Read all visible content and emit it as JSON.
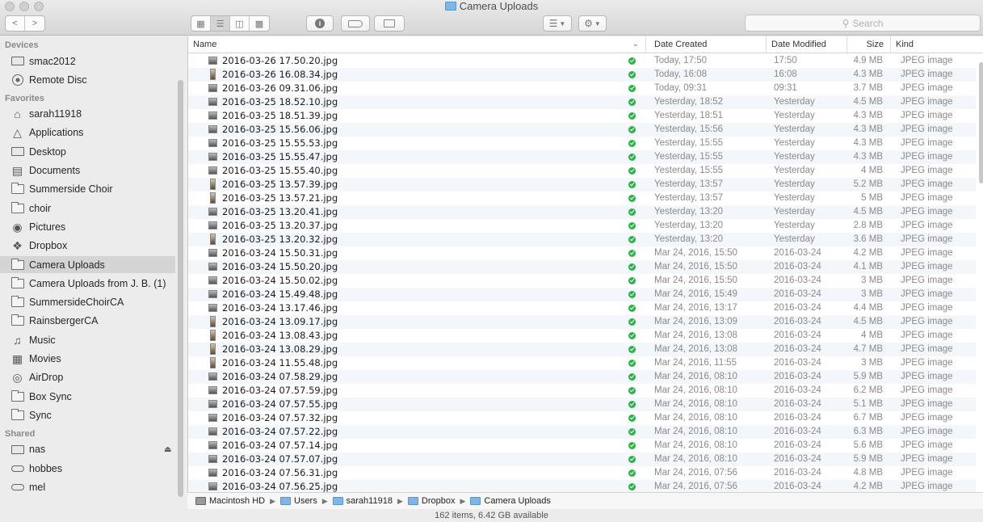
{
  "window": {
    "title": "Camera Uploads"
  },
  "toolbar": {
    "back_glyph": "<",
    "forward_glyph": ">",
    "view_icons": [
      "icon-view-icon",
      "list-view-icon",
      "column-view-icon",
      "coverflow-view-icon"
    ],
    "search_placeholder": "Search"
  },
  "sidebar": {
    "sections": [
      {
        "title": "Devices",
        "items": [
          {
            "label": "smac2012",
            "icon": "laptop-icon"
          },
          {
            "label": "Remote Disc",
            "icon": "disc-icon"
          }
        ]
      },
      {
        "title": "Favorites",
        "items": [
          {
            "label": "sarah11918",
            "icon": "home-icon"
          },
          {
            "label": "Applications",
            "icon": "applications-icon"
          },
          {
            "label": "Desktop",
            "icon": "desktop-icon"
          },
          {
            "label": "Documents",
            "icon": "documents-icon"
          },
          {
            "label": "Summerside Choir",
            "icon": "folder-icon"
          },
          {
            "label": "choir",
            "icon": "folder-icon"
          },
          {
            "label": "Pictures",
            "icon": "camera-icon"
          },
          {
            "label": "Dropbox",
            "icon": "dropbox-icon"
          },
          {
            "label": "Camera Uploads",
            "icon": "folder-icon",
            "selected": true
          },
          {
            "label": "Camera Uploads from J. B. (1)",
            "icon": "folder-icon"
          },
          {
            "label": "SummersideChoirCA",
            "icon": "folder-icon"
          },
          {
            "label": "RainsbergerCA",
            "icon": "folder-icon"
          },
          {
            "label": "Music",
            "icon": "music-icon"
          },
          {
            "label": "Movies",
            "icon": "movies-icon"
          },
          {
            "label": "AirDrop",
            "icon": "airdrop-icon"
          },
          {
            "label": "Box Sync",
            "icon": "folder-icon"
          },
          {
            "label": "Sync",
            "icon": "folder-icon"
          }
        ]
      },
      {
        "title": "Shared",
        "items": [
          {
            "label": "nas",
            "icon": "server-icon",
            "eject": true
          },
          {
            "label": "hobbes",
            "icon": "network-computer-icon"
          },
          {
            "label": "mel",
            "icon": "network-computer-icon"
          }
        ]
      }
    ]
  },
  "columns": {
    "name": "Name",
    "created": "Date Created",
    "modified": "Date Modified",
    "size": "Size",
    "kind": "Kind"
  },
  "files": [
    {
      "name": "2016-03-26 17.50.20.jpg",
      "created": "Today, 17:50",
      "modified": "17:50",
      "size": "4.9 MB",
      "kind": "JPEG image",
      "orient": "land"
    },
    {
      "name": "2016-03-26 16.08.34.jpg",
      "created": "Today, 16:08",
      "modified": "16:08",
      "size": "4.3 MB",
      "kind": "JPEG image",
      "orient": "port"
    },
    {
      "name": "2016-03-26 09.31.06.jpg",
      "created": "Today, 09:31",
      "modified": "09:31",
      "size": "3.7 MB",
      "kind": "JPEG image",
      "orient": "land"
    },
    {
      "name": "2016-03-25 18.52.10.jpg",
      "created": "Yesterday, 18:52",
      "modified": "Yesterday",
      "size": "4.5 MB",
      "kind": "JPEG image",
      "orient": "land"
    },
    {
      "name": "2016-03-25 18.51.39.jpg",
      "created": "Yesterday, 18:51",
      "modified": "Yesterday",
      "size": "4.3 MB",
      "kind": "JPEG image",
      "orient": "land"
    },
    {
      "name": "2016-03-25 15.56.06.jpg",
      "created": "Yesterday, 15:56",
      "modified": "Yesterday",
      "size": "4.3 MB",
      "kind": "JPEG image",
      "orient": "land"
    },
    {
      "name": "2016-03-25 15.55.53.jpg",
      "created": "Yesterday, 15:55",
      "modified": "Yesterday",
      "size": "4.3 MB",
      "kind": "JPEG image",
      "orient": "land"
    },
    {
      "name": "2016-03-25 15.55.47.jpg",
      "created": "Yesterday, 15:55",
      "modified": "Yesterday",
      "size": "4.3 MB",
      "kind": "JPEG image",
      "orient": "land"
    },
    {
      "name": "2016-03-25 15.55.40.jpg",
      "created": "Yesterday, 15:55",
      "modified": "Yesterday",
      "size": "4 MB",
      "kind": "JPEG image",
      "orient": "land"
    },
    {
      "name": "2016-03-25 13.57.39.jpg",
      "created": "Yesterday, 13:57",
      "modified": "Yesterday",
      "size": "5.2 MB",
      "kind": "JPEG image",
      "orient": "port"
    },
    {
      "name": "2016-03-25 13.57.21.jpg",
      "created": "Yesterday, 13:57",
      "modified": "Yesterday",
      "size": "5 MB",
      "kind": "JPEG image",
      "orient": "port"
    },
    {
      "name": "2016-03-25 13.20.41.jpg",
      "created": "Yesterday, 13:20",
      "modified": "Yesterday",
      "size": "4.5 MB",
      "kind": "JPEG image",
      "orient": "land"
    },
    {
      "name": "2016-03-25 13.20.37.jpg",
      "created": "Yesterday, 13:20",
      "modified": "Yesterday",
      "size": "2.8 MB",
      "kind": "JPEG image",
      "orient": "land"
    },
    {
      "name": "2016-03-25 13.20.32.jpg",
      "created": "Yesterday, 13:20",
      "modified": "Yesterday",
      "size": "3.6 MB",
      "kind": "JPEG image",
      "orient": "port"
    },
    {
      "name": "2016-03-24 15.50.31.jpg",
      "created": "Mar 24, 2016, 15:50",
      "modified": "2016-03-24",
      "size": "4.2 MB",
      "kind": "JPEG image",
      "orient": "land"
    },
    {
      "name": "2016-03-24 15.50.20.jpg",
      "created": "Mar 24, 2016, 15:50",
      "modified": "2016-03-24",
      "size": "4.1 MB",
      "kind": "JPEG image",
      "orient": "land"
    },
    {
      "name": "2016-03-24 15.50.02.jpg",
      "created": "Mar 24, 2016, 15:50",
      "modified": "2016-03-24",
      "size": "3 MB",
      "kind": "JPEG image",
      "orient": "land"
    },
    {
      "name": "2016-03-24 15.49.48.jpg",
      "created": "Mar 24, 2016, 15:49",
      "modified": "2016-03-24",
      "size": "3 MB",
      "kind": "JPEG image",
      "orient": "land"
    },
    {
      "name": "2016-03-24 13.17.46.jpg",
      "created": "Mar 24, 2016, 13:17",
      "modified": "2016-03-24",
      "size": "4.4 MB",
      "kind": "JPEG image",
      "orient": "land"
    },
    {
      "name": "2016-03-24 13.09.17.jpg",
      "created": "Mar 24, 2016, 13:09",
      "modified": "2016-03-24",
      "size": "4.5 MB",
      "kind": "JPEG image",
      "orient": "port"
    },
    {
      "name": "2016-03-24 13.08.43.jpg",
      "created": "Mar 24, 2016, 13:08",
      "modified": "2016-03-24",
      "size": "4 MB",
      "kind": "JPEG image",
      "orient": "port"
    },
    {
      "name": "2016-03-24 13.08.29.jpg",
      "created": "Mar 24, 2016, 13:08",
      "modified": "2016-03-24",
      "size": "4.7 MB",
      "kind": "JPEG image",
      "orient": "port"
    },
    {
      "name": "2016-03-24 11.55.48.jpg",
      "created": "Mar 24, 2016, 11:55",
      "modified": "2016-03-24",
      "size": "3 MB",
      "kind": "JPEG image",
      "orient": "port"
    },
    {
      "name": "2016-03-24 07.58.29.jpg",
      "created": "Mar 24, 2016, 08:10",
      "modified": "2016-03-24",
      "size": "5.9 MB",
      "kind": "JPEG image",
      "orient": "land"
    },
    {
      "name": "2016-03-24 07.57.59.jpg",
      "created": "Mar 24, 2016, 08:10",
      "modified": "2016-03-24",
      "size": "6.2 MB",
      "kind": "JPEG image",
      "orient": "land"
    },
    {
      "name": "2016-03-24 07.57.55.jpg",
      "created": "Mar 24, 2016, 08:10",
      "modified": "2016-03-24",
      "size": "5.1 MB",
      "kind": "JPEG image",
      "orient": "land"
    },
    {
      "name": "2016-03-24 07.57.32.jpg",
      "created": "Mar 24, 2016, 08:10",
      "modified": "2016-03-24",
      "size": "6.7 MB",
      "kind": "JPEG image",
      "orient": "land"
    },
    {
      "name": "2016-03-24 07.57.22.jpg",
      "created": "Mar 24, 2016, 08:10",
      "modified": "2016-03-24",
      "size": "6.3 MB",
      "kind": "JPEG image",
      "orient": "land"
    },
    {
      "name": "2016-03-24 07.57.14.jpg",
      "created": "Mar 24, 2016, 08:10",
      "modified": "2016-03-24",
      "size": "5.6 MB",
      "kind": "JPEG image",
      "orient": "land"
    },
    {
      "name": "2016-03-24 07.57.07.jpg",
      "created": "Mar 24, 2016, 08:10",
      "modified": "2016-03-24",
      "size": "5.9 MB",
      "kind": "JPEG image",
      "orient": "land"
    },
    {
      "name": "2016-03-24 07.56.31.jpg",
      "created": "Mar 24, 2016, 07:56",
      "modified": "2016-03-24",
      "size": "4.8 MB",
      "kind": "JPEG image",
      "orient": "land"
    },
    {
      "name": "2016-03-24 07.56.25.jpg",
      "created": "Mar 24, 2016, 07:56",
      "modified": "2016-03-24",
      "size": "4.2 MB",
      "kind": "JPEG image",
      "orient": "land"
    }
  ],
  "path": [
    "Macintosh HD",
    "Users",
    "sarah11918",
    "Dropbox",
    "Camera Uploads"
  ],
  "status": "162 items, 6.42 GB available"
}
